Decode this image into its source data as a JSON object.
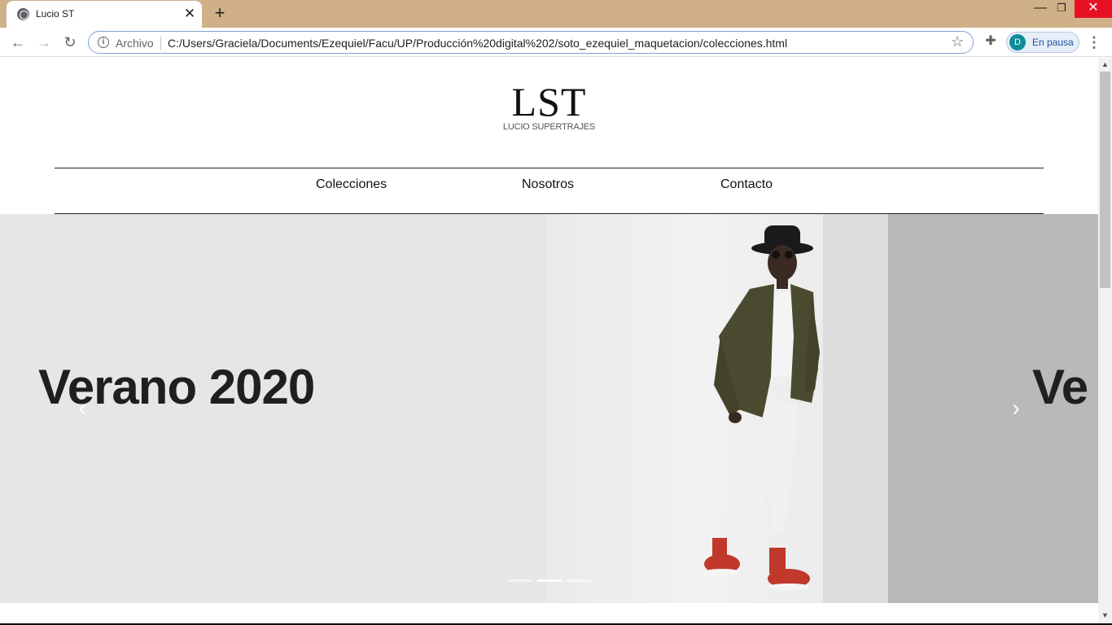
{
  "browser": {
    "tab_title": "Lucio ST",
    "tab_close": "✕",
    "new_tab": "+",
    "window_controls": {
      "minimize": "—",
      "maximize": "❐",
      "close": "✕"
    },
    "nav": {
      "back": "←",
      "forward": "→",
      "reload": "↻"
    },
    "omnibox": {
      "scheme_label": "Archivo",
      "url": "C:/Users/Graciela/Documents/Ezequiel/Facu/UP/Producción%20digital%202/soto_ezequiel_maquetacion/colecciones.html"
    },
    "icons": {
      "info": "i",
      "star": "☆",
      "extensions": "✚",
      "menu": "⋮"
    },
    "profile": {
      "initial": "D",
      "status": "En pausa",
      "avatar_color": "#0f8c9a"
    },
    "tab_strip_color": "#cfb088"
  },
  "site": {
    "logo_mark": "LST",
    "logo_subtitle": "LUCIO SUPERTRAJES",
    "nav_links": [
      "Colecciones",
      "Nosotros",
      "Contacto"
    ]
  },
  "carousel": {
    "slide_title": "Verano 2020",
    "next_slide_title_partial": "Ve",
    "prev_icon": "‹",
    "next_icon": "›",
    "indicator_count": 3,
    "active_indicator": 1
  },
  "scrollbar": {
    "up": "▲",
    "down": "▼"
  }
}
